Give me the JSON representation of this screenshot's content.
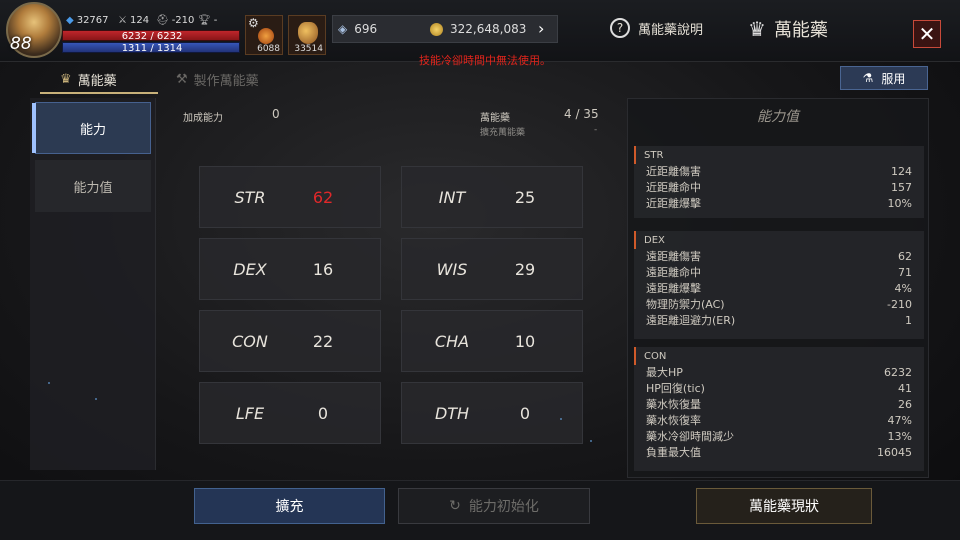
{
  "player": {
    "level": "88",
    "combat_power": "32767",
    "attack": "124",
    "defense": "-210",
    "trophy": "-",
    "hp_text": "6232 / 6232",
    "mp_text": "1311 / 1314"
  },
  "items": [
    {
      "icon": "potion-icon",
      "count": "6088"
    },
    {
      "icon": "horn-icon",
      "count": "33514"
    }
  ],
  "currency": {
    "gems": "696",
    "gold": "322,648,083"
  },
  "warning": "技能冷卻時間中無法使用。",
  "header": {
    "help_label": "萬能藥說明",
    "title": "萬能藥",
    "close_label": "✕"
  },
  "tabs": [
    {
      "label": "萬能藥",
      "active": true
    },
    {
      "label": "製作萬能藥",
      "active": false
    }
  ],
  "use_button": "服用",
  "nav": [
    {
      "label": "能力",
      "active": true
    },
    {
      "label": "能力值",
      "active": false
    }
  ],
  "info": {
    "bonus_label": "加成能力",
    "bonus_value": "0",
    "elixir_label": "萬能藥",
    "elixir_value": "4 / 35",
    "expand_label": "擴充萬能藥",
    "expand_value": "-"
  },
  "stats": [
    {
      "name": "STR",
      "value": "62",
      "color": "#e0282a"
    },
    {
      "name": "INT",
      "value": "25",
      "color": "#e8e4dc"
    },
    {
      "name": "DEX",
      "value": "16",
      "color": "#e8e4dc"
    },
    {
      "name": "WIS",
      "value": "29",
      "color": "#e8e4dc"
    },
    {
      "name": "CON",
      "value": "22",
      "color": "#e8e4dc"
    },
    {
      "name": "CHA",
      "value": "10",
      "color": "#e8e4dc"
    },
    {
      "name": "LFE",
      "value": "0",
      "color": "#e8e4dc"
    },
    {
      "name": "DTH",
      "value": "0",
      "color": "#e8e4dc"
    }
  ],
  "ability_panel": {
    "title": "能力值",
    "sections": [
      {
        "name": "STR",
        "rows": [
          {
            "label": "近距離傷害",
            "value": "124"
          },
          {
            "label": "近距離命中",
            "value": "157"
          },
          {
            "label": "近距離爆擊",
            "value": "10%"
          }
        ]
      },
      {
        "name": "DEX",
        "rows": [
          {
            "label": "遠距離傷害",
            "value": "62"
          },
          {
            "label": "遠距離命中",
            "value": "71"
          },
          {
            "label": "遠距離爆擊",
            "value": "4%"
          },
          {
            "label": "物理防禦力(AC)",
            "value": "-210"
          },
          {
            "label": "遠距離迴避力(ER)",
            "value": "1"
          }
        ]
      },
      {
        "name": "CON",
        "rows": [
          {
            "label": "最大HP",
            "value": "6232"
          },
          {
            "label": "HP回復(tic)",
            "value": "41"
          },
          {
            "label": "藥水恢復量",
            "value": "26"
          },
          {
            "label": "藥水恢復率",
            "value": "47%"
          },
          {
            "label": "藥水冷卻時間減少",
            "value": "13%"
          },
          {
            "label": "負重最大值",
            "value": "16045"
          }
        ]
      }
    ]
  },
  "buttons": {
    "expand": "擴充",
    "reset": "能力初始化",
    "status": "萬能藥現狀"
  }
}
